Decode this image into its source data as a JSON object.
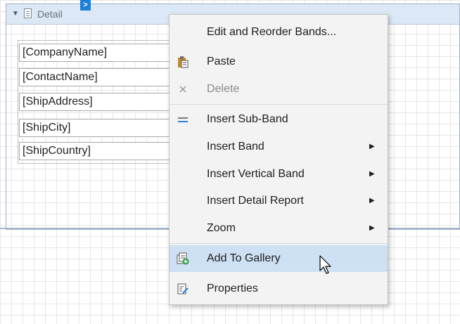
{
  "band": {
    "toggle_glyph": "▼",
    "title": "Detail",
    "smart_tag_glyph": ">"
  },
  "fields": [
    "[CompanyName]",
    "[ContactName]",
    "[ShipAddress]",
    "[ShipCity]",
    "[ShipCountry]"
  ],
  "context_menu": {
    "items": [
      {
        "label": "Edit and Reorder Bands...",
        "icon": "none",
        "enabled": true
      },
      {
        "label": "Paste",
        "icon": "paste-icon",
        "enabled": true
      },
      {
        "label": "Delete",
        "icon": "close-icon",
        "enabled": false
      },
      {
        "label": "Insert Sub-Band",
        "icon": "sub-band-icon",
        "enabled": true
      },
      {
        "label": "Insert Band",
        "icon": "none",
        "enabled": true,
        "submenu_glyph": "▶"
      },
      {
        "label": "Insert Vertical Band",
        "icon": "none",
        "enabled": true,
        "submenu_glyph": "▶"
      },
      {
        "label": "Insert Detail Report",
        "icon": "none",
        "enabled": true,
        "submenu_glyph": "▶"
      },
      {
        "label": "Zoom",
        "icon": "none",
        "enabled": true,
        "submenu_glyph": "▶"
      },
      {
        "label": "Add To Gallery",
        "icon": "gallery-add-icon",
        "enabled": true,
        "highlighted": true
      },
      {
        "label": "Properties",
        "icon": "properties-icon",
        "enabled": true
      }
    ]
  },
  "colors": {
    "band_header": "#dce8f5",
    "smart_tag": "#1e7fd6",
    "menu_background": "#f3f3f3",
    "menu_highlight": "#cde0f4",
    "grid_line": "#e6e6e6"
  }
}
